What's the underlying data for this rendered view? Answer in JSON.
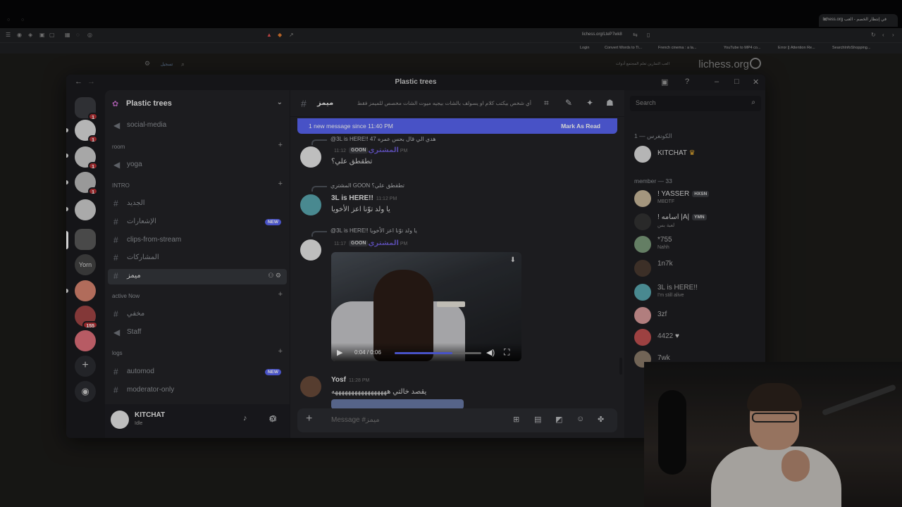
{
  "browser": {
    "tab_title": "في إنتظار الخصم - العب lichess.org",
    "url": "lichess.org/LteP7wk8",
    "bookmarks": [
      "Login",
      "Convert Words to Ti...",
      "French cinema : a la...",
      "YouTube to MP4 co...",
      "Error || Attention Re...",
      "SearchInfoShopping..."
    ]
  },
  "lichess": {
    "logo": "lichess.org",
    "nav": "العب   التمارين   تعلم   المجتمع   أدوات",
    "signin": "تسجيل"
  },
  "discord": {
    "window_title": "Plastic trees",
    "server_badges": [
      "1",
      "1",
      "1",
      "1",
      "155"
    ],
    "server_yorn_label": "Yorn",
    "guild_name": "Plastic trees",
    "channels": {
      "social": "social-media",
      "cat_room": "room",
      "yoga": "yoga",
      "cat_intro": "INTRO",
      "intro_new": "الجديد",
      "intro_notif": "الإشعارات",
      "new_badge": "NEW",
      "clips": "clips-from-stream",
      "sharing": "المشاركات",
      "mimz": "ميمز",
      "cat_active": "active Now",
      "hidden": "مخفي",
      "staff": "Staff",
      "cat_logs": "logs",
      "automod": "automod",
      "automod_badge": "NEW",
      "modonly": "moderator-only"
    },
    "user": {
      "name": "KITCHAT",
      "status": "Idle"
    },
    "chat": {
      "channel": "ميمز",
      "topic": "أي شخص بيكتب كلام او يسولف بالشات بيجيه ميوت الشات مخصص للميمز فقط",
      "new_messages": "1 new message since 11:40 PM",
      "mark_read": "Mark As Read",
      "messages": [
        {
          "reply": "@3L is HERE!! هدي الي قال بحس عمره 47",
          "author": "المشتري",
          "tag": "GOON",
          "time": "11:12 PM",
          "text": "تطقطق علي؟"
        },
        {
          "reply": "المشتري  GOON تطقطق علي؟",
          "author": "3L is HERE!!",
          "time": "11:12 PM",
          "text": "يا ولد توّنا اعز الأخويا"
        },
        {
          "reply": "@3L is HERE!! يا ولد توّنا اعز الأخويا",
          "author": "المشتري",
          "tag": "GOON",
          "time": "11:17 PM",
          "video_time": "0:04 / 0:06",
          "video_progress": 0.67
        },
        {
          "author": "Yosf",
          "time": "11:28 PM",
          "text": "يقصد خالتي هههههههههههههههههه"
        }
      ],
      "composer_placeholder": "Message #ميمز"
    },
    "members": {
      "search_placeholder": "Search",
      "cat_owner": "الكونغرس — 1",
      "owner": {
        "name": "KITCHAT",
        "crown": "♛"
      },
      "cat_member": "member — 33",
      "list": [
        {
          "name": "! YASSER",
          "tag": "HXSN",
          "status": "MBDTF",
          "color": "#d8d8d8"
        },
        {
          "name": "! اسامه |A|",
          "tag": "YMN",
          "status": "لعبة بس",
          "color": "#d8d8d8"
        },
        {
          "name": "*755",
          "status": "Nahh",
          "color": "#aaa"
        },
        {
          "name": "1n7k",
          "status": "",
          "color": "#aaa"
        },
        {
          "name": "3L is HERE!!",
          "status": "I'm still alive",
          "color": "#aaa"
        },
        {
          "name": "3zf",
          "status": "",
          "color": "#aaa"
        },
        {
          "name": "4422",
          "status": "",
          "color": "#aaa"
        },
        {
          "name": "7wk",
          "status": "",
          "color": "#aaa"
        }
      ]
    }
  }
}
